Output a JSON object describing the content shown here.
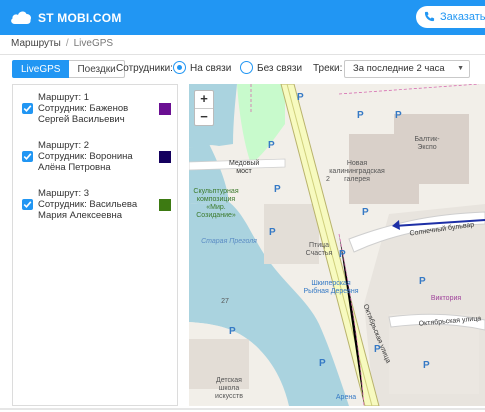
{
  "header": {
    "brand": "ST MOBI.COM",
    "order_button": "Заказать звонок",
    "icons": [
      "cloud-icon",
      "phone-icon"
    ]
  },
  "breadcrumb": {
    "root": "Маршруты",
    "separator": "/",
    "current": "LiveGPS"
  },
  "tabs": [
    {
      "label": "LiveGPS",
      "active": true
    },
    {
      "label": "Поездки",
      "active": false
    }
  ],
  "filters": {
    "employees_label": "Сотрудники:",
    "options": [
      {
        "label": "На связи",
        "selected": true
      },
      {
        "label": "Без связи",
        "selected": false
      }
    ],
    "tracks_label": "Треки:",
    "tracks_value": "За последние 2 часа"
  },
  "routes": [
    {
      "line1": "Маршрут: 1",
      "line2": "Сотрудник: Баженов",
      "line3": "Сергей Васильевич",
      "checked": true,
      "color": "#6a0f92"
    },
    {
      "line1": "Маршрут: 2",
      "line2": "Сотрудник: Воронина",
      "line3": "Алёна Петровна",
      "checked": true,
      "color": "#14005e"
    },
    {
      "line1": "Маршрут: 3",
      "line2": "Сотрудник: Васильева",
      "line3": "Мария Алексеевна",
      "checked": true,
      "color": "#3d7a12"
    }
  ],
  "map": {
    "zoom_in": "+",
    "zoom_out": "−",
    "labels": {
      "bridge": "Медовый мост",
      "monument": "Скульптурная композиция «Мир. Созидание»",
      "river": "Старая Преголя",
      "street1": "Октябрьская улица",
      "street2": "Октябрьская улица",
      "boulevard": "Солнечный бульвар",
      "expo": "Балтик-Экспо",
      "gallery": "Новая калининградская галерея",
      "bird": "Птица Счастья",
      "fishvillage": "Шкиперская Рыбная Деревня",
      "victoria": "Виктория",
      "arena": "Арена",
      "school": "Детская школа искусств",
      "num": "27",
      "hospital": "2"
    }
  }
}
